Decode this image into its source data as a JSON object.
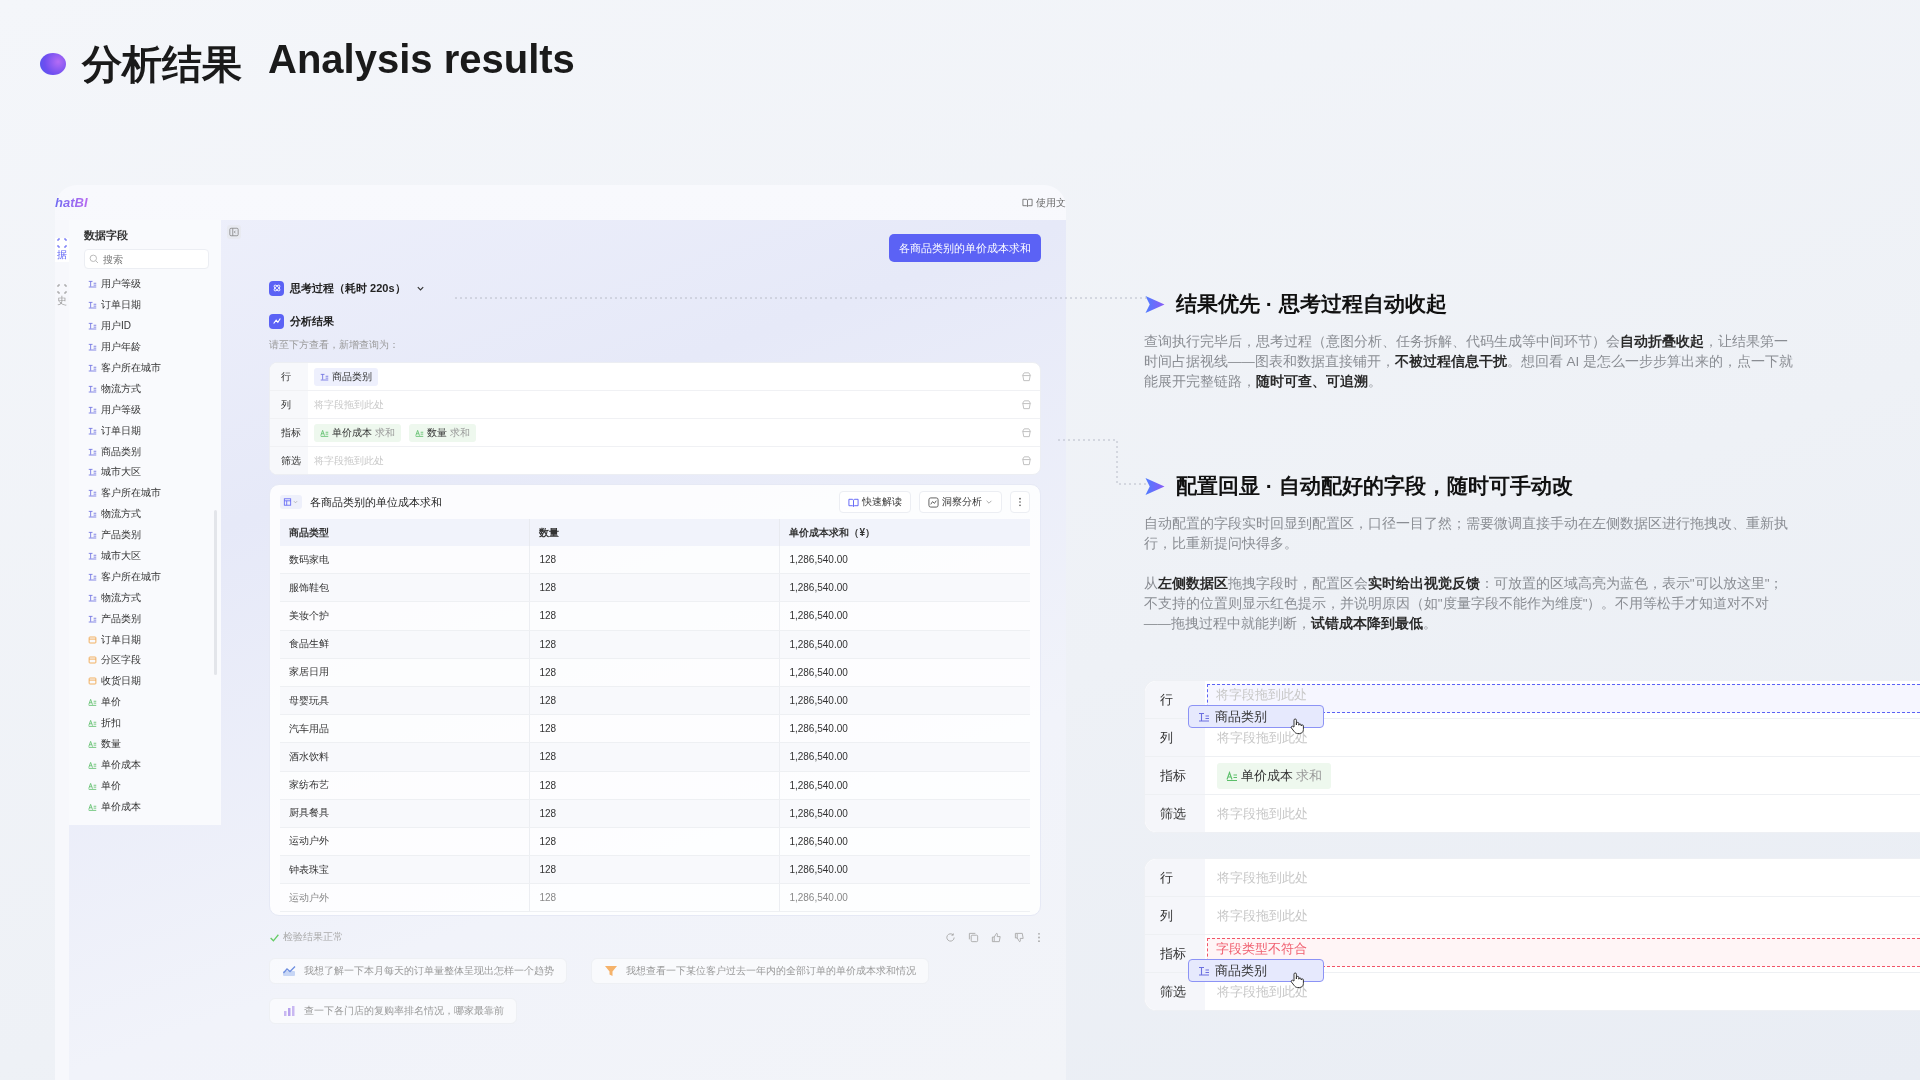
{
  "title": {
    "zh": "分析结果",
    "en": "Analysis results"
  },
  "app": {
    "logo": "hatBI",
    "docs_link": "使用文",
    "nav": [
      {
        "label": "据",
        "selected": true
      },
      {
        "label": "史",
        "selected": false
      }
    ],
    "sidebar": {
      "title": "数据字段",
      "search_placeholder": "搜索",
      "fields": [
        {
          "label": "用户等级",
          "kind": "text"
        },
        {
          "label": "订单日期",
          "kind": "text"
        },
        {
          "label": "用户ID",
          "kind": "text"
        },
        {
          "label": "用户年龄",
          "kind": "text"
        },
        {
          "label": "客户所在城市",
          "kind": "text"
        },
        {
          "label": "物流方式",
          "kind": "text"
        },
        {
          "label": "用户等级",
          "kind": "text"
        },
        {
          "label": "订单日期",
          "kind": "text"
        },
        {
          "label": "商品类别",
          "kind": "text"
        },
        {
          "label": "城市大区",
          "kind": "text"
        },
        {
          "label": "客户所在城市",
          "kind": "text"
        },
        {
          "label": "物流方式",
          "kind": "text"
        },
        {
          "label": "产品类别",
          "kind": "text"
        },
        {
          "label": "城市大区",
          "kind": "text"
        },
        {
          "label": "客户所在城市",
          "kind": "text"
        },
        {
          "label": "物流方式",
          "kind": "text"
        },
        {
          "label": "产品类别",
          "kind": "text"
        },
        {
          "label": "订单日期",
          "kind": "date"
        },
        {
          "label": "分区字段",
          "kind": "date"
        },
        {
          "label": "收货日期",
          "kind": "date"
        },
        {
          "label": "单价",
          "kind": "number"
        },
        {
          "label": "折扣",
          "kind": "number"
        },
        {
          "label": "数量",
          "kind": "number"
        },
        {
          "label": "单价成本",
          "kind": "number"
        },
        {
          "label": "单价",
          "kind": "number"
        },
        {
          "label": "单价成本",
          "kind": "number"
        }
      ]
    },
    "query_bubble": "各商品类别的单价成本求和",
    "thinking": {
      "label": "思考过程（耗时 220s）",
      "expanded": false
    },
    "result": {
      "label": "分析结果",
      "hint": "请至下方查看，新增查询为："
    },
    "config": [
      {
        "label": "行",
        "chips": [
          {
            "kind": "text",
            "name": "商品类别"
          }
        ]
      },
      {
        "label": "列",
        "placeholder": "将字段拖到此处"
      },
      {
        "label": "指标",
        "chips": [
          {
            "kind": "number",
            "name": "单价成本",
            "agg": "求和"
          },
          {
            "kind": "number",
            "name": "数量",
            "agg": "求和"
          }
        ]
      },
      {
        "label": "筛选",
        "placeholder": "将字段拖到此处"
      }
    ],
    "table_card": {
      "title": "各商品类别的单位成本求和",
      "buttons": [
        {
          "label": "快速解读",
          "kind": "read"
        },
        {
          "label": "洞察分析",
          "kind": "insight"
        }
      ],
      "columns": [
        "商品类型",
        "数量",
        "单价成本求和（¥）"
      ],
      "rows": [
        [
          "数码家电",
          "128",
          "1,286,540.00"
        ],
        [
          "服饰鞋包",
          "128",
          "1,286,540.00"
        ],
        [
          "美妆个护",
          "128",
          "1,286,540.00"
        ],
        [
          "食品生鲜",
          "128",
          "1,286,540.00"
        ],
        [
          "家居日用",
          "128",
          "1,286,540.00"
        ],
        [
          "母婴玩具",
          "128",
          "1,286,540.00"
        ],
        [
          "汽车用品",
          "128",
          "1,286,540.00"
        ],
        [
          "酒水饮料",
          "128",
          "1,286,540.00"
        ],
        [
          "家纺布艺",
          "128",
          "1,286,540.00"
        ],
        [
          "厨具餐具",
          "128",
          "1,286,540.00"
        ],
        [
          "运动户外",
          "128",
          "1,286,540.00"
        ],
        [
          "钟表珠宝",
          "128",
          "1,286,540.00"
        ],
        [
          "运动户外",
          "128",
          "1,286,540.00"
        ]
      ]
    },
    "check": "检验结果正常",
    "suggestions": [
      {
        "text": "我想了解一下本月每天的订单量整体呈现出怎样一个趋势",
        "kind": "line"
      },
      {
        "text": "我想查看一下某位客户过去一年内的全部订单的单价成本求和情况",
        "kind": "funnel"
      },
      {
        "text": "查一下各门店的复购率排名情况，哪家最靠前",
        "kind": "bar"
      }
    ]
  },
  "features": [
    {
      "heading": "结果优先 · 思考过程自动收起",
      "paragraphs": [
        "查询执行完毕后，思考过程（意图分析、任务拆解、代码生成等中间环节）会**自动折叠收起**，让结果第一时间占据视线——图表和数据直接铺开，**不被过程信息干扰**。想回看 AI 是怎么一步步算出来的，点一下就能展开完整链路，**随时可查、可追溯**。"
      ]
    },
    {
      "heading": "配置回显 · 自动配好的字段，随时可手动改",
      "paragraphs": [
        "自动配置的字段实时回显到配置区，口径一目了然；需要微调直接手动在左侧数据区进行拖拽改、重新执行，比重新提问快得多。",
        "从**左侧数据区**拖拽字段时，配置区会**实时给出视觉反馈**：可放置的区域高亮为蓝色，表示\"可以放这里\"；不支持的位置则显示红色提示，并说明原因（如\"度量字段不能作为维度\"）。不用等松手才知道对不对——拖拽过程中就能判断，**试错成本降到最低**。"
      ]
    }
  ],
  "demos": [
    {
      "rows": [
        {
          "label": "行",
          "placeholder": "将字段拖到此处",
          "kind": "drop-allowed",
          "dragged_chip": {
            "kind": "text",
            "name": "商品类别"
          }
        },
        {
          "label": "列",
          "placeholder": "将字段拖到此处"
        },
        {
          "label": "指标",
          "chips": [
            {
              "kind": "number",
              "name": "单价成本",
              "agg": "求和"
            }
          ]
        },
        {
          "label": "筛选",
          "placeholder": "将字段拖到此处"
        }
      ]
    },
    {
      "rows": [
        {
          "label": "行",
          "placeholder": "将字段拖到此处"
        },
        {
          "label": "列",
          "placeholder": "将字段拖到此处"
        },
        {
          "label": "指标",
          "error": "字段类型不符合",
          "kind": "drop-rejected",
          "dragged_chip": {
            "kind": "text",
            "name": "商品类别"
          }
        },
        {
          "label": "筛选",
          "placeholder": "将字段拖到此处"
        }
      ]
    }
  ]
}
